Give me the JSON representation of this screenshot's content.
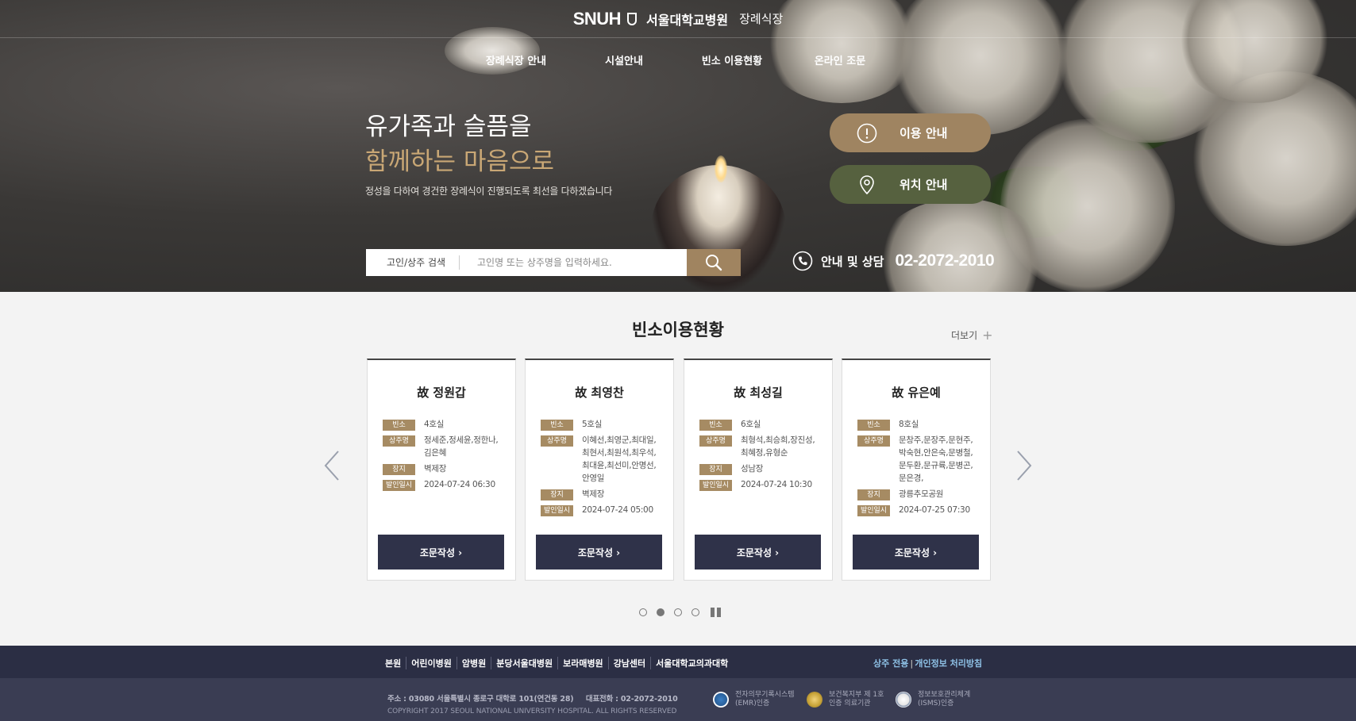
{
  "header": {
    "logo_snuh": "SNUH",
    "logo_hospital": "서울대학교병원",
    "logo_sub": "장례식장"
  },
  "nav": [
    "장례식장 안내",
    "시설안내",
    "빈소 이용현황",
    "온라인 조문"
  ],
  "hero": {
    "headline_1": "유가족과 슬픔을",
    "headline_2": "함께하는 마음으로",
    "subcopy": "정성을 다하여 경건한 장례식이 진행되도록 최선을 다하겠습니다",
    "guide_button": "이용 안내",
    "location_button": "위치 안내"
  },
  "search": {
    "category": "고인/상주 검색",
    "placeholder": "고인명 또는 상주명을 입력하세요."
  },
  "contact": {
    "label": "안내 및 상담",
    "phone": "02-2072-2010"
  },
  "section": {
    "title": "빈소이용현황",
    "more": "더보기"
  },
  "labels": {
    "room": "빈소",
    "mourner": "상주명",
    "burial": "장지",
    "departure": "발인일시",
    "condolence_button": "조문작성 ›"
  },
  "cards": [
    {
      "name": "故 정원갑",
      "room": "4호실",
      "mourners": "정세준,정세윤,정한나,\n김은혜",
      "burial": "벽제장",
      "departure": "2024-07-24 06:30"
    },
    {
      "name": "故 최영찬",
      "room": "5호실",
      "mourners": "이혜선,최영군,최대일,\n최현서,최원석,최우석,\n최대윤,최선미,안명선,\n안영일",
      "burial": "벽제장",
      "departure": "2024-07-24 05:00"
    },
    {
      "name": "故 최성길",
      "room": "6호실",
      "mourners": "최형석,최승희,장진성,\n최혜정,유형순",
      "burial": "성남장",
      "departure": "2024-07-24 10:30"
    },
    {
      "name": "故 유은예",
      "room": "8호실",
      "mourners": "문창주,문장주,문현주,\n박숙현,안은숙,문병철,\n문두환,문규륙,문병곤,\n문은경,",
      "burial": "광릉추모공원",
      "departure": "2024-07-25 07:30"
    }
  ],
  "pager": {
    "active_index": 2,
    "total": 4
  },
  "footer": {
    "links": [
      "본원",
      "어린이병원",
      "암병원",
      "분당서울대병원",
      "보라매병원",
      "강남센터",
      "서울대학교의과대학"
    ],
    "right_1": "상주 전용",
    "right_2": "개인정보 처리방침",
    "address": "주소 : 03080 서울특별시 종로구 대학로 101(연건동 28)     대표전화 : 02-2072-2010",
    "copyright": "COPYRIGHT 2017 SEOUL NATIONAL UNIVERSITY HOSPITAL. ALL RIGHTS RESERVED",
    "certs": [
      {
        "line1": "전자의무기록시스템",
        "line2": "(EMR)인증"
      },
      {
        "line1": "보건복지부 제 1호",
        "line2": "인증 의료기관"
      },
      {
        "line1": "정보보호관리체계",
        "line2": "(ISMS)인증"
      }
    ]
  },
  "colors": {
    "accent_gold": "#a08460",
    "accent_green": "#56613f",
    "navy": "#2f3249",
    "footer_link_blue": "#8ec1e6"
  }
}
